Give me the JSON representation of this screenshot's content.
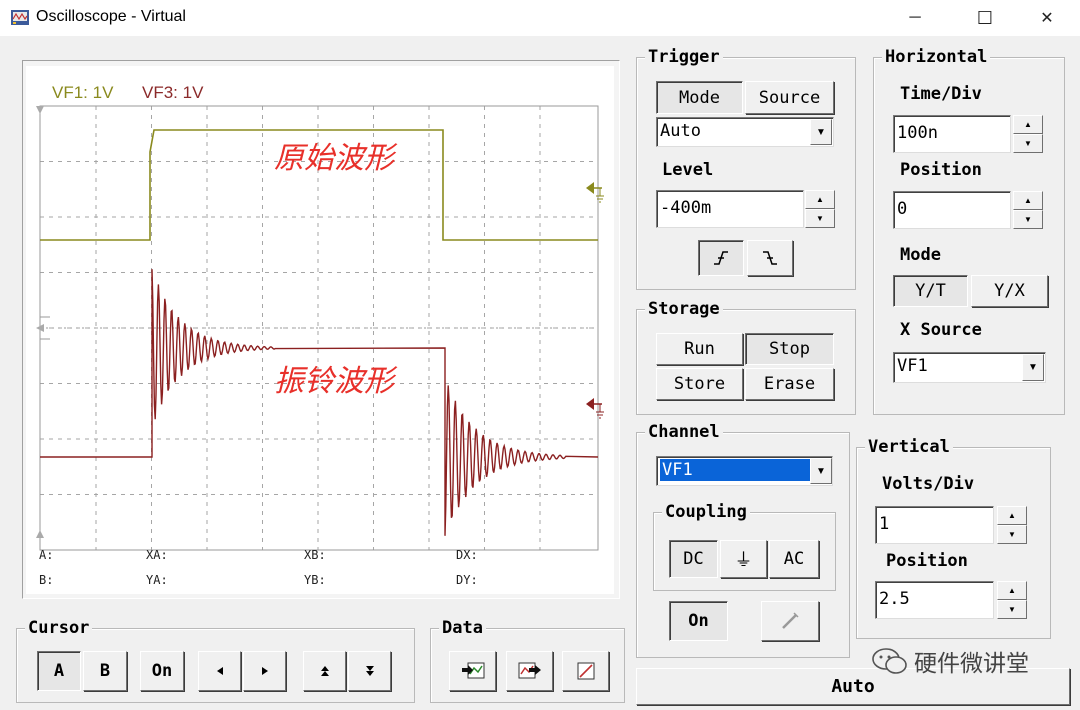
{
  "window": {
    "title": "Oscilloscope - Virtual",
    "minimize_glyph": "─",
    "maximize_glyph": "☐",
    "close_glyph": "✕"
  },
  "scope": {
    "channel_labels": [
      {
        "text": "VF1: 1V",
        "color": "#8a8a1e"
      },
      {
        "text": "VF3: 1V",
        "color": "#8b2a2a"
      }
    ],
    "annotations": [
      "原始波形",
      "振铃波形"
    ],
    "readouts": [
      "A:",
      "XA:",
      "XB:",
      "DX:",
      "B:",
      "YA:",
      "YB:",
      "DY:"
    ],
    "colors": {
      "vf1": "#8a8a1e",
      "vf3": "#8b2020",
      "grid": "#9a9a9a",
      "annotation": "#e8302a"
    }
  },
  "trigger": {
    "title": "Trigger",
    "mode_label": "Mode",
    "source_label": "Source",
    "mode_value": "Auto",
    "level_label": "Level",
    "level_value": "-400m",
    "rising_edge_icon": "rising-edge-icon",
    "falling_edge_icon": "falling-edge-icon"
  },
  "horizontal": {
    "title": "Horizontal",
    "timediv_label": "Time/Div",
    "timediv_value": "100n",
    "position_label": "Position",
    "position_value": "0",
    "mode_label": "Mode",
    "yt_label": "Y/T",
    "yx_label": "Y/X",
    "xsource_label": "X Source",
    "xsource_value": "VF1"
  },
  "storage": {
    "title": "Storage",
    "run": "Run",
    "stop": "Stop",
    "store": "Store",
    "erase": "Erase"
  },
  "channel": {
    "title": "Channel",
    "selected": "VF1",
    "coupling_title": "Coupling",
    "dc": "DC",
    "gnd": "⏚",
    "ac": "AC",
    "on": "On"
  },
  "vertical": {
    "title": "Vertical",
    "voltsdiv_label": "Volts/Div",
    "voltsdiv_value": "1",
    "position_label": "Position",
    "position_value": "2.5"
  },
  "cursor": {
    "title": "Cursor",
    "a": "A",
    "b": "B",
    "on": "On"
  },
  "data": {
    "title": "Data"
  },
  "auto": "Auto",
  "watermark": "硬件微讲堂"
}
